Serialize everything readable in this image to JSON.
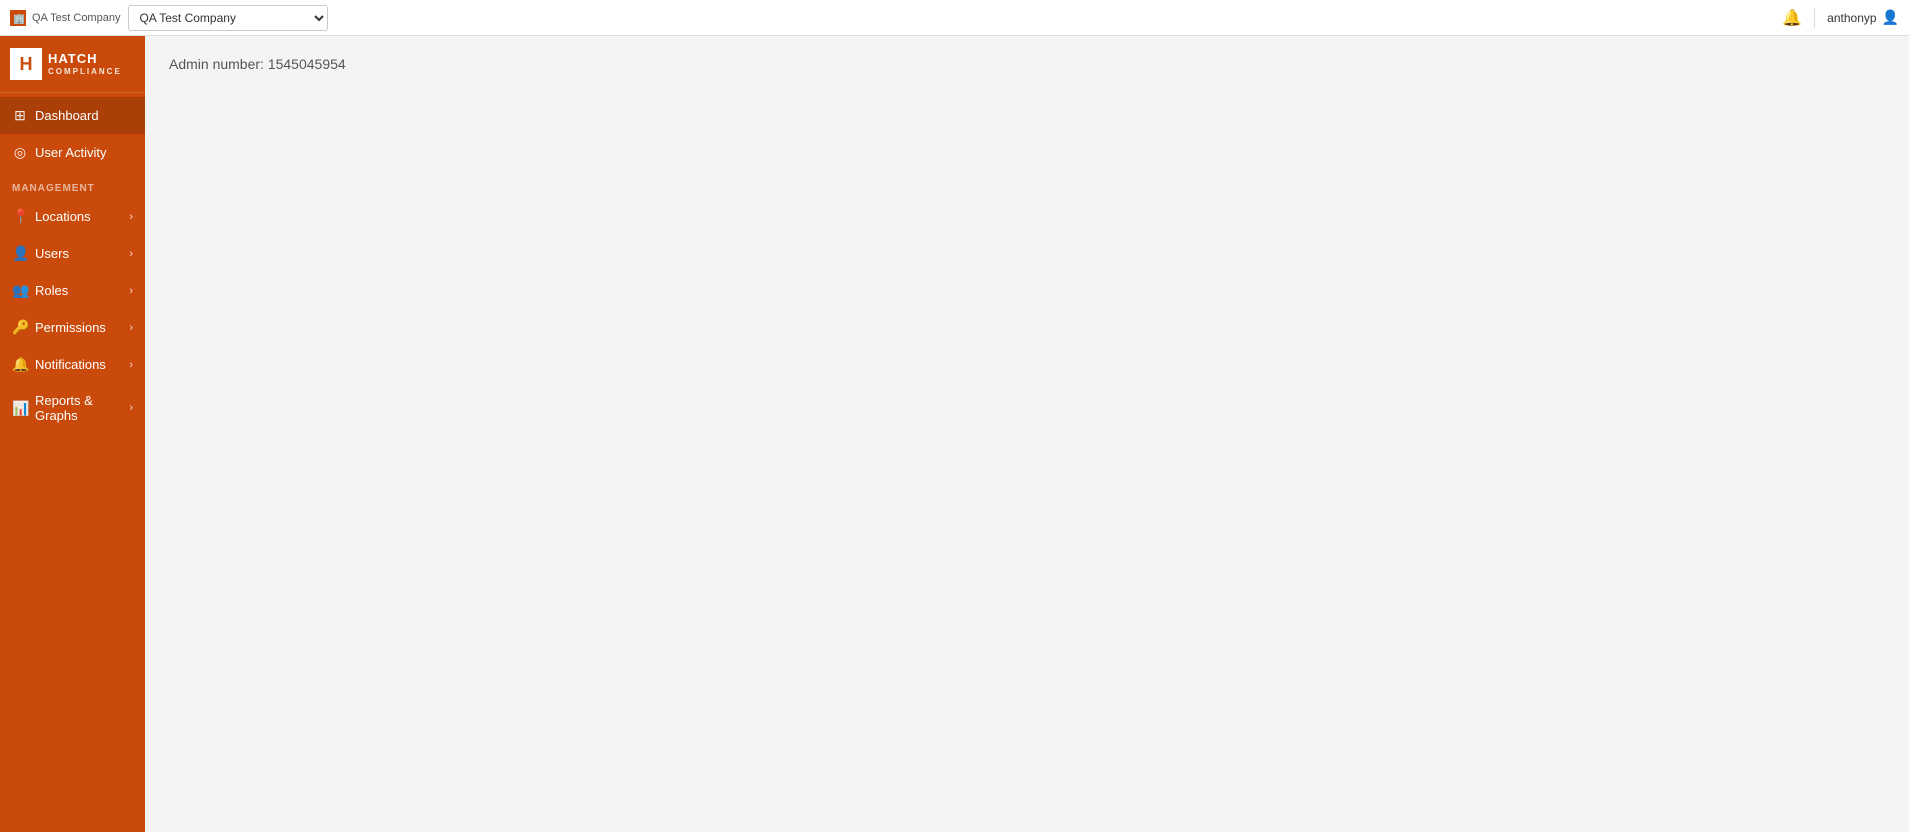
{
  "topbar": {
    "company_icon_label": "building-icon",
    "company_tab_label": "QA Test Company",
    "company_select_value": "QA Test Company",
    "company_select_options": [
      "QA Test Company"
    ],
    "bell_icon": "bell-icon",
    "username": "anthonyp",
    "user_icon": "user-icon"
  },
  "sidebar": {
    "logo": {
      "symbol": "H",
      "brand_top": "HATCH",
      "brand_bottom": "COMPLIANCE"
    },
    "nav_items": [
      {
        "id": "dashboard",
        "label": "Dashboard",
        "icon": "grid-icon",
        "has_chevron": false,
        "active": true
      },
      {
        "id": "user-activity",
        "label": "User Activity",
        "icon": "activity-icon",
        "has_chevron": false,
        "active": false
      }
    ],
    "section_label": "MANAGEMENT",
    "management_items": [
      {
        "id": "locations",
        "label": "Locations",
        "icon": "pin-icon",
        "has_chevron": true
      },
      {
        "id": "users",
        "label": "Users",
        "icon": "person-icon",
        "has_chevron": true
      },
      {
        "id": "roles",
        "label": "Roles",
        "icon": "people-icon",
        "has_chevron": true
      },
      {
        "id": "permissions",
        "label": "Permissions",
        "icon": "key-icon",
        "has_chevron": true
      },
      {
        "id": "notifications",
        "label": "Notifications",
        "icon": "bell-icon",
        "has_chevron": true
      },
      {
        "id": "reports-graphs",
        "label": "Reports & Graphs",
        "icon": "chart-icon",
        "has_chevron": true
      }
    ]
  },
  "content": {
    "admin_number_label": "Admin number: 1545045954"
  }
}
